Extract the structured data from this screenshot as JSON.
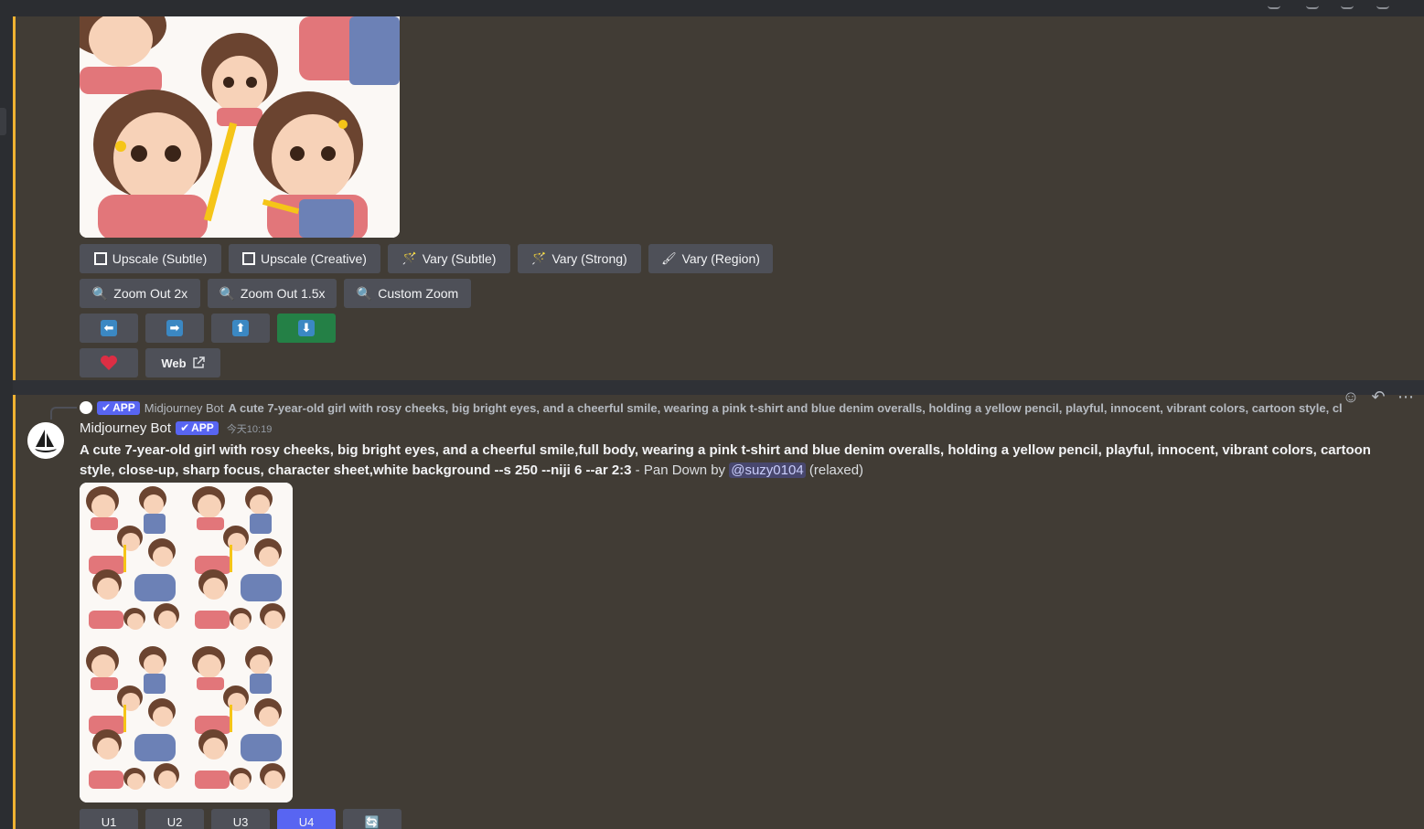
{
  "upper_message": {
    "buttons_row1": [
      {
        "icon": "fullscreen-icon",
        "label": "Upscale (Subtle)"
      },
      {
        "icon": "fullscreen-icon",
        "label": "Upscale (Creative)"
      },
      {
        "icon": "magic-wand-icon",
        "label": "Vary (Subtle)"
      },
      {
        "icon": "magic-wand-icon",
        "label": "Vary (Strong)"
      },
      {
        "icon": "paintbrush-icon",
        "label": "Vary (Region)"
      }
    ],
    "buttons_row2": [
      {
        "icon": "magnifier-icon",
        "label": "Zoom Out 2x"
      },
      {
        "icon": "magnifier-icon",
        "label": "Zoom Out 1.5x"
      },
      {
        "icon": "magnifier-icon",
        "label": "Custom Zoom"
      }
    ],
    "pan_buttons": [
      {
        "icon": "arrow-left-icon",
        "glyph": "⬅"
      },
      {
        "icon": "arrow-right-icon",
        "glyph": "➡"
      },
      {
        "icon": "arrow-up-icon",
        "glyph": "⬆"
      },
      {
        "icon": "arrow-down-icon",
        "glyph": "⬇",
        "active": true
      }
    ],
    "favorite_icon": "heart-icon",
    "web_label": "Web"
  },
  "lower_message": {
    "reply": {
      "app_badge": "APP",
      "username": "Midjourney Bot",
      "text": "A cute 7-year-old girl with rosy cheeks, big bright eyes, and a cheerful smile, wearing a pink t-shirt and blue denim overalls, holding a yellow pencil, playful, innocent, vibrant colors, cartoon style, close-up..."
    },
    "username": "Midjourney Bot",
    "app_badge": "APP",
    "timestamp": "今天10:19",
    "prompt": "A cute 7-year-old girl with rosy cheeks, big bright eyes, and a cheerful smile,full body, wearing a pink t-shirt and blue denim overalls, holding a yellow pencil, playful, innocent, vibrant colors, cartoon style, close-up, sharp focus, character sheet,white background --s 250 --niji 6 --ar 2:3",
    "suffix": " - Pan Down by ",
    "mention": "@suzy0104",
    "mode": " (relaxed)",
    "bottom_buttons": [
      "U1",
      "U2",
      "U3",
      "U4",
      "🔄"
    ]
  },
  "colors": {
    "accent": "#5865f2",
    "highlight_bar": "#f0b232",
    "green": "#248046"
  }
}
